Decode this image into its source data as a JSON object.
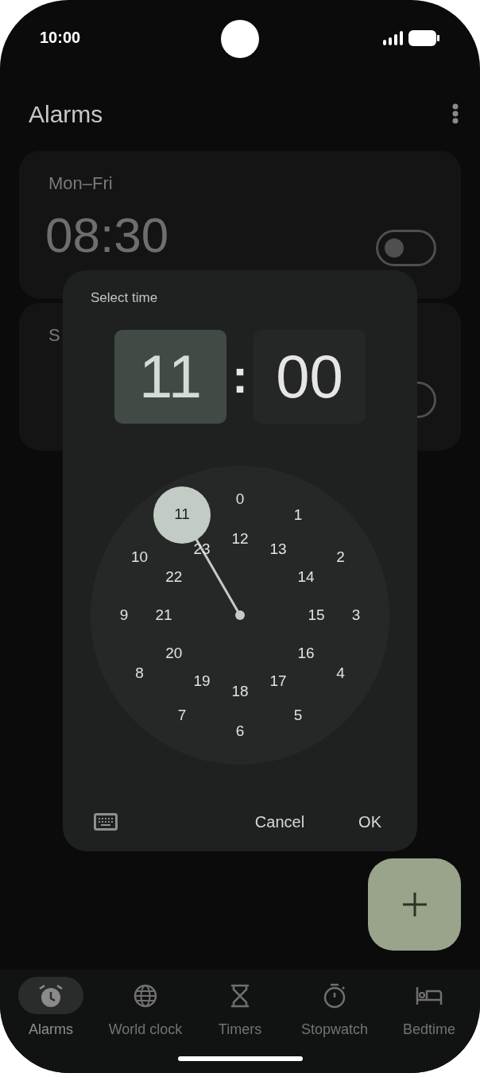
{
  "status_bar": {
    "time": "10:00"
  },
  "header": {
    "title": "Alarms"
  },
  "alarms": [
    {
      "days": "Mon–Fri",
      "time": "08:30",
      "on": false
    },
    {
      "days": "S",
      "on": false
    }
  ],
  "dialog": {
    "title": "Select time",
    "hour": {
      "value": "11",
      "selected": true
    },
    "separator": ":",
    "minute": {
      "value": "00",
      "selected": false
    },
    "dial": {
      "outer": [
        {
          "label": "0",
          "selected": false
        },
        {
          "label": "1",
          "selected": false
        },
        {
          "label": "2",
          "selected": false
        },
        {
          "label": "3",
          "selected": false
        },
        {
          "label": "4",
          "selected": false
        },
        {
          "label": "5",
          "selected": false
        },
        {
          "label": "6",
          "selected": false
        },
        {
          "label": "7",
          "selected": false
        },
        {
          "label": "8",
          "selected": false
        },
        {
          "label": "9",
          "selected": false
        },
        {
          "label": "10",
          "selected": false
        },
        {
          "label": "11",
          "selected": true
        }
      ],
      "inner": [
        {
          "label": "12",
          "selected": false
        },
        {
          "label": "13",
          "selected": false
        },
        {
          "label": "14",
          "selected": false
        },
        {
          "label": "15",
          "selected": false
        },
        {
          "label": "16",
          "selected": false
        },
        {
          "label": "17",
          "selected": false
        },
        {
          "label": "18",
          "selected": false
        },
        {
          "label": "19",
          "selected": false
        },
        {
          "label": "20",
          "selected": false
        },
        {
          "label": "21",
          "selected": false
        },
        {
          "label": "22",
          "selected": false
        },
        {
          "label": "23",
          "selected": false
        }
      ]
    },
    "actions": [
      "Cancel",
      "OK"
    ]
  },
  "nav": [
    {
      "label": "Alarms",
      "kind": "alarm",
      "selected": true
    },
    {
      "label": "World clock",
      "kind": "globe",
      "selected": false
    },
    {
      "label": "Timers",
      "kind": "hourglass",
      "selected": false
    },
    {
      "label": "Stopwatch",
      "kind": "stopwatch",
      "selected": false
    },
    {
      "label": "Bedtime",
      "kind": "bed",
      "selected": false
    }
  ]
}
